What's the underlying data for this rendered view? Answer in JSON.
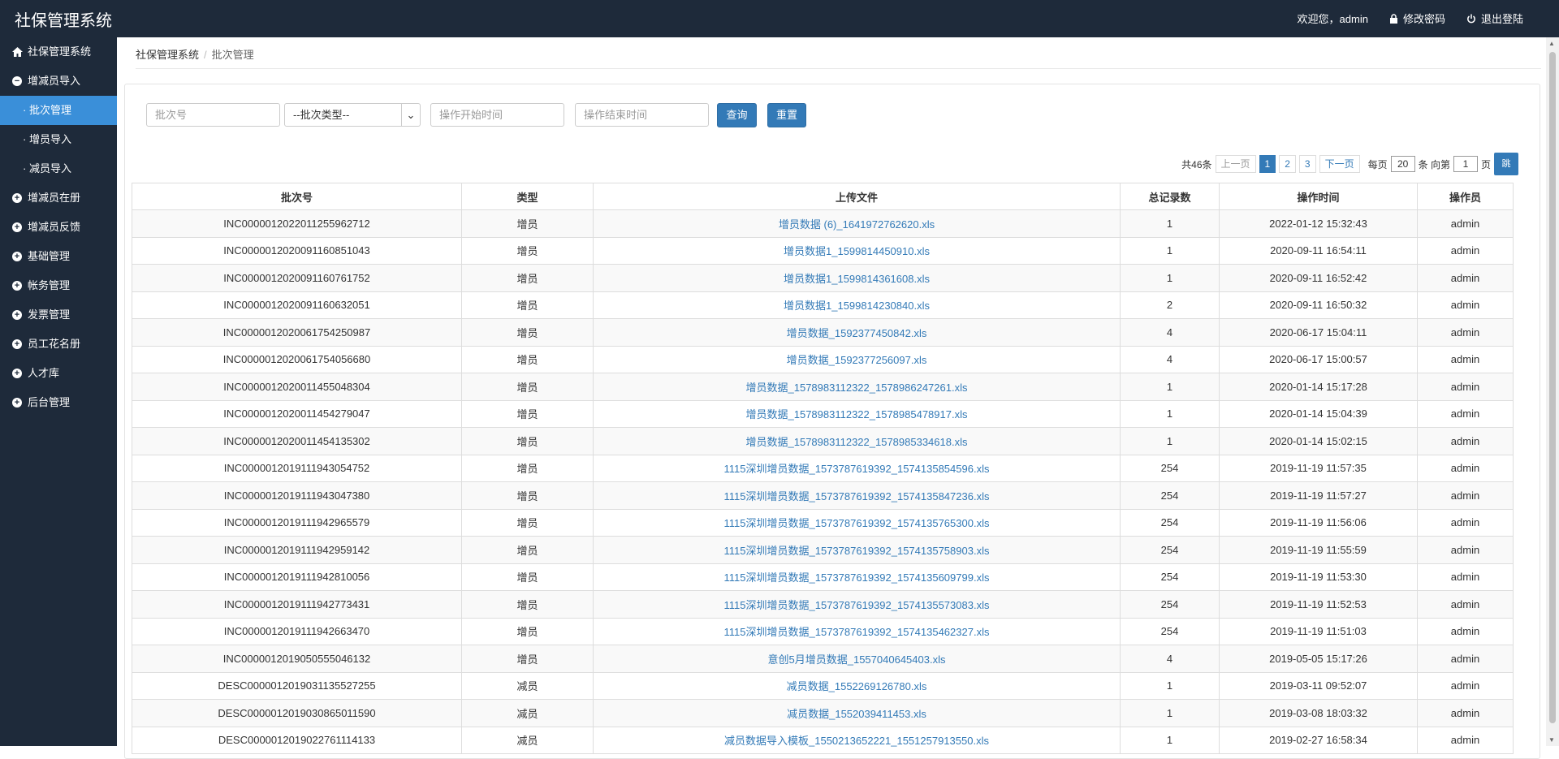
{
  "app": {
    "title": "社保管理系统"
  },
  "topbar": {
    "welcome": "欢迎您，admin",
    "change_password": "修改密码",
    "logout": "退出登陆"
  },
  "sidebar": {
    "items": [
      {
        "label": "社保管理系统",
        "icon": "home-icon"
      },
      {
        "label": "增减员导入",
        "icon": "minus-circle-icon"
      },
      {
        "label": "批次管理",
        "sub": true,
        "active": true
      },
      {
        "label": "增员导入",
        "sub": true
      },
      {
        "label": "减员导入",
        "sub": true
      },
      {
        "label": "增减员在册",
        "icon": "plus-circle-icon"
      },
      {
        "label": "增减员反馈",
        "icon": "plus-circle-icon"
      },
      {
        "label": "基础管理",
        "icon": "plus-circle-icon"
      },
      {
        "label": "帐务管理",
        "icon": "plus-circle-icon"
      },
      {
        "label": "发票管理",
        "icon": "plus-circle-icon"
      },
      {
        "label": "员工花名册",
        "icon": "plus-circle-icon"
      },
      {
        "label": "人才库",
        "icon": "plus-circle-icon"
      },
      {
        "label": "后台管理",
        "icon": "plus-circle-icon"
      }
    ]
  },
  "breadcrumb": {
    "root": "社保管理系统",
    "sep": "/",
    "current": "批次管理"
  },
  "filters": {
    "batch_placeholder": "批次号",
    "type_select": "--批次类型--",
    "start_placeholder": "操作开始时间",
    "end_placeholder": "操作结束时间",
    "query": "查询",
    "reset": "重置"
  },
  "pager": {
    "total": "共46条",
    "prev": "上一页",
    "pages": [
      "1",
      "2",
      "3"
    ],
    "next": "下一页",
    "per_page_label": "每页",
    "per_page": "20",
    "unit1": "条 向第",
    "goto": "1",
    "unit2": "页",
    "go": "跳"
  },
  "table": {
    "headers": [
      "批次号",
      "类型",
      "上传文件",
      "总记录数",
      "操作时间",
      "操作员"
    ],
    "rows": [
      [
        "INC0000012022011255962712",
        "增员",
        "增员数据 (6)_1641972762620.xls",
        "1",
        "2022-01-12 15:32:43",
        "admin"
      ],
      [
        "INC0000012020091160851043",
        "增员",
        "增员数据1_1599814450910.xls",
        "1",
        "2020-09-11 16:54:11",
        "admin"
      ],
      [
        "INC0000012020091160761752",
        "增员",
        "增员数据1_1599814361608.xls",
        "1",
        "2020-09-11 16:52:42",
        "admin"
      ],
      [
        "INC0000012020091160632051",
        "增员",
        "增员数据1_1599814230840.xls",
        "2",
        "2020-09-11 16:50:32",
        "admin"
      ],
      [
        "INC0000012020061754250987",
        "增员",
        "增员数据_1592377450842.xls",
        "4",
        "2020-06-17 15:04:11",
        "admin"
      ],
      [
        "INC0000012020061754056680",
        "增员",
        "增员数据_1592377256097.xls",
        "4",
        "2020-06-17 15:00:57",
        "admin"
      ],
      [
        "INC0000012020011455048304",
        "增员",
        "增员数据_1578983112322_1578986247261.xls",
        "1",
        "2020-01-14 15:17:28",
        "admin"
      ],
      [
        "INC0000012020011454279047",
        "增员",
        "增员数据_1578983112322_1578985478917.xls",
        "1",
        "2020-01-14 15:04:39",
        "admin"
      ],
      [
        "INC0000012020011454135302",
        "增员",
        "增员数据_1578983112322_1578985334618.xls",
        "1",
        "2020-01-14 15:02:15",
        "admin"
      ],
      [
        "INC0000012019111943054752",
        "增员",
        "1115深圳增员数据_1573787619392_1574135854596.xls",
        "254",
        "2019-11-19 11:57:35",
        "admin"
      ],
      [
        "INC0000012019111943047380",
        "增员",
        "1115深圳增员数据_1573787619392_1574135847236.xls",
        "254",
        "2019-11-19 11:57:27",
        "admin"
      ],
      [
        "INC0000012019111942965579",
        "增员",
        "1115深圳增员数据_1573787619392_1574135765300.xls",
        "254",
        "2019-11-19 11:56:06",
        "admin"
      ],
      [
        "INC0000012019111942959142",
        "增员",
        "1115深圳增员数据_1573787619392_1574135758903.xls",
        "254",
        "2019-11-19 11:55:59",
        "admin"
      ],
      [
        "INC0000012019111942810056",
        "增员",
        "1115深圳增员数据_1573787619392_1574135609799.xls",
        "254",
        "2019-11-19 11:53:30",
        "admin"
      ],
      [
        "INC0000012019111942773431",
        "增员",
        "1115深圳增员数据_1573787619392_1574135573083.xls",
        "254",
        "2019-11-19 11:52:53",
        "admin"
      ],
      [
        "INC0000012019111942663470",
        "增员",
        "1115深圳增员数据_1573787619392_1574135462327.xls",
        "254",
        "2019-11-19 11:51:03",
        "admin"
      ],
      [
        "INC0000012019050555046132",
        "增员",
        "意创5月增员数据_1557040645403.xls",
        "4",
        "2019-05-05 15:17:26",
        "admin"
      ],
      [
        "DESC0000012019031135527255",
        "减员",
        "减员数据_1552269126780.xls",
        "1",
        "2019-03-11 09:52:07",
        "admin"
      ],
      [
        "DESC0000012019030865011590",
        "减员",
        "减员数据_1552039411453.xls",
        "1",
        "2019-03-08 18:03:32",
        "admin"
      ],
      [
        "DESC0000012019022761114133",
        "减员",
        "减员数据导入模板_1550213652221_1551257913550.xls",
        "1",
        "2019-02-27 16:58:34",
        "admin"
      ]
    ]
  }
}
